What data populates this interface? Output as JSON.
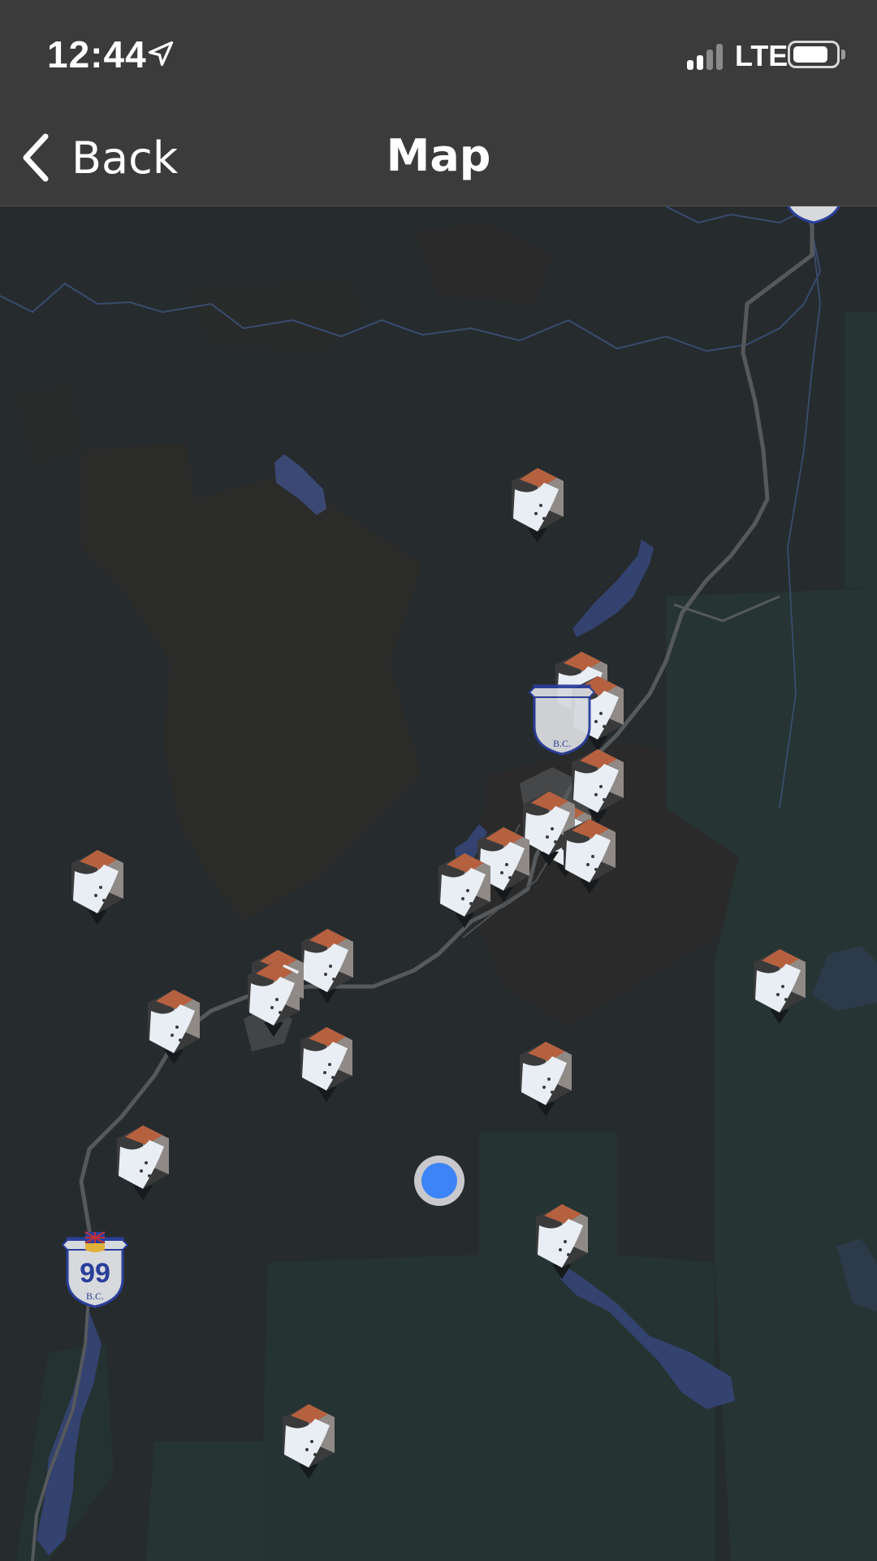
{
  "status_bar": {
    "time": "12:44",
    "location_icon": "location-arrow-icon",
    "signal_bars_active": 2,
    "signal_bars_total": 4,
    "carrier": "LTE",
    "battery_level": 0.8
  },
  "nav": {
    "back_label": "Back",
    "title": "Map",
    "back_icon": "chevron-left-icon"
  },
  "map": {
    "marker_icon": "ski-area-icon",
    "marker_count": 20,
    "highway_shields": [
      {
        "number": "99",
        "sub": "B.C."
      },
      {
        "number": "",
        "sub": "B.C."
      }
    ]
  },
  "colors": {
    "bar_background": "#3b3b3c",
    "map_background": "#262b2e",
    "water": "#33426e",
    "user_location": "#3c84f7",
    "marker_peak": "#b5613f",
    "marker_snow": "#e9eef5"
  }
}
